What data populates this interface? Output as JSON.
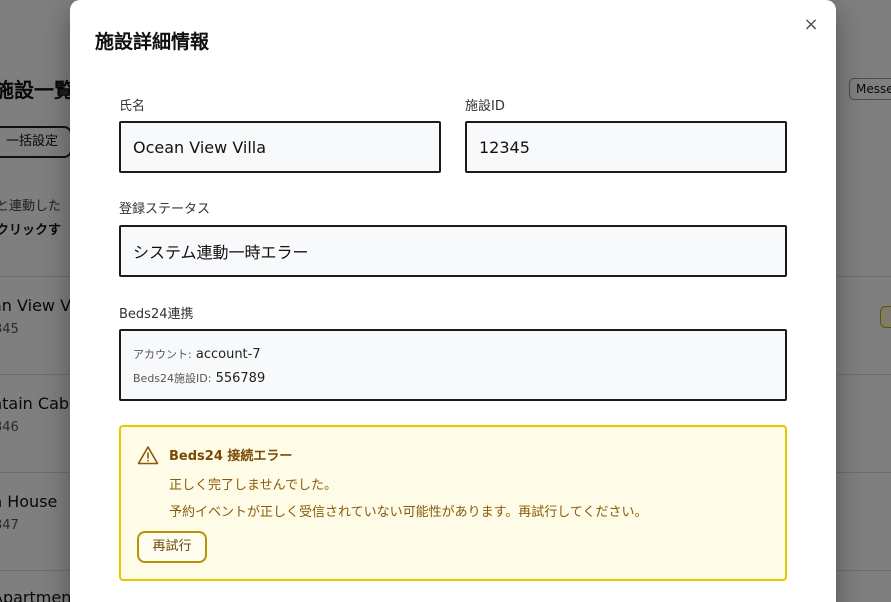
{
  "background": {
    "page_title": "施設一覧",
    "bulk_settings_label": "一括設定",
    "description_line1": "と連動した",
    "description_line2": "クリックす",
    "message_button_label": "Messe",
    "rows": [
      {
        "name": "an View Vi",
        "id": "345"
      },
      {
        "name": "ntain Cabi",
        "id": "346"
      },
      {
        "name": "h House",
        "id": "347"
      },
      {
        "name": "Apartmen",
        "id": ""
      }
    ]
  },
  "modal": {
    "title": "施設詳細情報",
    "close_glyph": "×",
    "name_label": "氏名",
    "name_value": "Ocean View Villa",
    "facility_id_label": "施設ID",
    "facility_id_value": "12345",
    "status_label": "登録ステータス",
    "status_value": "システム連動一時エラー",
    "beds24": {
      "section_label": "Beds24連携",
      "account_key": "アカウント:",
      "account_value": "account-7",
      "property_key": "Beds24施設ID:",
      "property_value": "556789"
    },
    "alert": {
      "icon": "warning-icon",
      "title": "Beds24 接続エラー",
      "message1": "正しく完了しませんでした。",
      "message2": "予約イベントが正しく受信されていない可能性があります。再試行してください。",
      "retry_label": "再試行"
    }
  },
  "colors": {
    "alert_background": "#fefbe6",
    "alert_border": "#e5c900",
    "alert_text": "#8a5a0a"
  }
}
